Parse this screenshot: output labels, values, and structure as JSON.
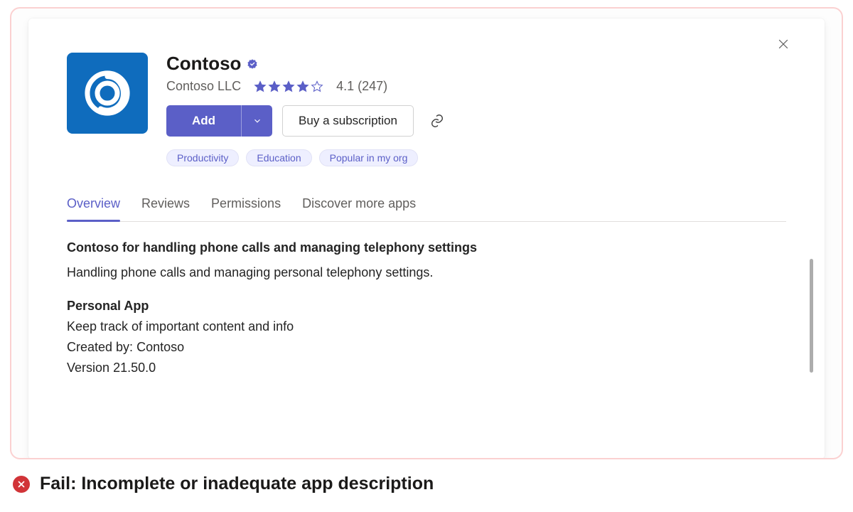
{
  "app": {
    "name": "Contoso",
    "publisher": "Contoso LLC",
    "rating": 4.1,
    "rating_display": "4.1 (247)",
    "review_count": 247,
    "stars_filled": 4,
    "stars_total": 5
  },
  "buttons": {
    "add_label": "Add",
    "buy_label": "Buy a subscription"
  },
  "tags": [
    "Productivity",
    "Education",
    "Popular in my org"
  ],
  "tabs": [
    {
      "label": "Overview",
      "active": true
    },
    {
      "label": "Reviews",
      "active": false
    },
    {
      "label": "Permissions",
      "active": false
    },
    {
      "label": "Discover more apps",
      "active": false
    }
  ],
  "overview": {
    "headline": "Contoso for handling phone calls and managing telephony settings",
    "summary": "Handling phone calls and managing personal telephony settings.",
    "section_title": "Personal App",
    "line1": "Keep track of important content and info",
    "created_by_label": "Created by:",
    "created_by_value": "Contoso",
    "version_label": "Version",
    "version_value": "21.50.0"
  },
  "colors": {
    "accent": "#5b5fc7",
    "icon_bg": "#0f6cbd",
    "fail": "#d13438"
  },
  "fail_banner": {
    "text": "Fail: Incomplete or inadequate app description"
  }
}
